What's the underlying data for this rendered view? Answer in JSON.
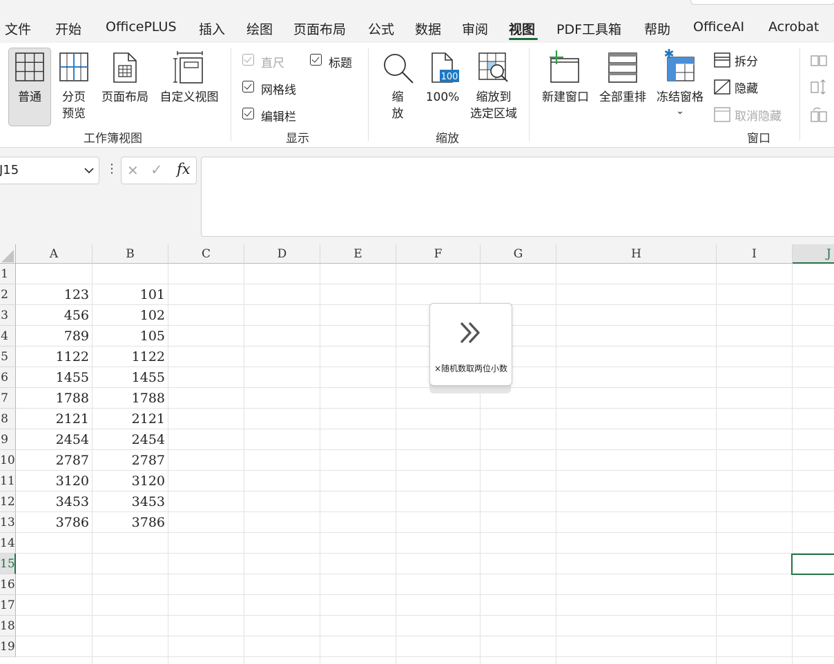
{
  "menu": {
    "items": [
      "文件",
      "开始",
      "OfficePLUS",
      "插入",
      "绘图",
      "页面布局",
      "公式",
      "数据",
      "审阅",
      "视图",
      "PDF工具箱",
      "帮助",
      "OfficeAI",
      "Acrobat"
    ],
    "active": "视图"
  },
  "ribbon": {
    "workbook_views": {
      "label": "工作簿视图",
      "normal": "普通",
      "page_break_1": "分页",
      "page_break_2": "预览",
      "page_layout": "页面布局",
      "custom_views": "自定义视图"
    },
    "show": {
      "label": "显示",
      "ruler": "直尺",
      "headings": "标题",
      "gridlines": "网格线",
      "formula_bar": "编辑栏"
    },
    "zoom": {
      "label": "缩放",
      "zoom_1": "缩",
      "zoom_2": "放",
      "hundred": "100%",
      "icon_text": "100",
      "zoom_sel_1": "缩放到",
      "zoom_sel_2": "选定区域"
    },
    "window": {
      "label": "窗口",
      "new_window": "新建窗口",
      "arrange_all": "全部重排",
      "freeze_panes": "冻结窗格",
      "split": "拆分",
      "hide": "隐藏",
      "unhide": "取消隐藏"
    }
  },
  "formula_bar": {
    "name_box": "J15",
    "cancel_glyph": "✕",
    "enter_glyph": "✓",
    "fx": "fx",
    "more_glyph": "⋮",
    "value": ""
  },
  "sheet": {
    "columns": [
      "A",
      "B",
      "C",
      "D",
      "E",
      "F",
      "G",
      "H",
      "I",
      "J"
    ],
    "rows": [
      "1",
      "2",
      "3",
      "4",
      "5",
      "6",
      "7",
      "8",
      "9",
      "10",
      "11",
      "12",
      "13",
      "14",
      "15",
      "16",
      "17",
      "18",
      "19"
    ],
    "colA": [
      "",
      "123",
      "456",
      "789",
      "1122",
      "1455",
      "1788",
      "2121",
      "2454",
      "2787",
      "3120",
      "3453",
      "3786"
    ],
    "colB": [
      "",
      "101",
      "102",
      "105",
      "1122",
      "1455",
      "1788",
      "2121",
      "2454",
      "2787",
      "3120",
      "3453",
      "3786"
    ],
    "selected_cell": "J15"
  },
  "floating_panel": {
    "label": "×随机数取两位小数",
    "icon": "double-chevron-right-icon"
  }
}
